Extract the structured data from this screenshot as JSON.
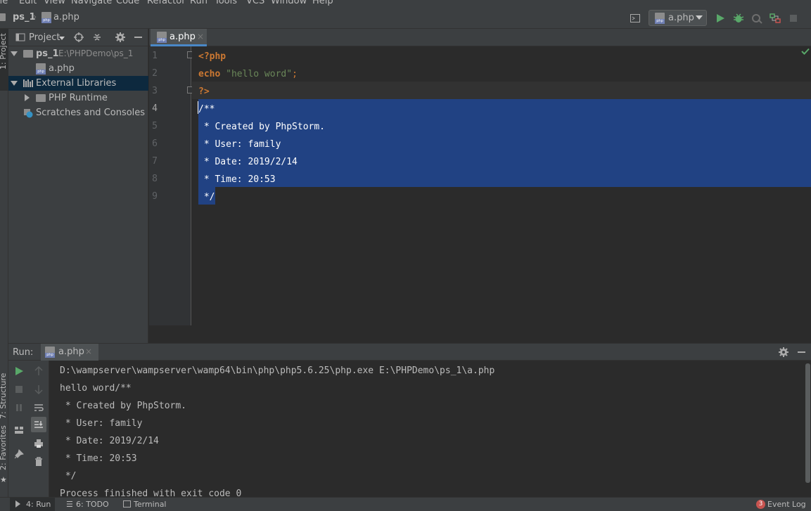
{
  "menu": [
    "ile",
    "Edit",
    "View",
    "Navigate",
    "Code",
    "Refactor",
    "Run",
    "Tools",
    "VCS",
    "Window",
    "Help"
  ],
  "navbar": {
    "project_crumb": "ps_1",
    "file_crumb": "a.php",
    "run_config": "a.php"
  },
  "left_stripe": {
    "project_tab": "1: Project",
    "structure_tab": "7: Structure",
    "favorites_tab": "2: Favorites"
  },
  "project_panel": {
    "view_selector": "Project",
    "tree": [
      {
        "label": "ps_1",
        "path": "E:\\PHPDemo\\ps_1"
      },
      {
        "label": "a.php"
      },
      {
        "label": "External Libraries"
      },
      {
        "label": "PHP Runtime"
      },
      {
        "label": "Scratches and Consoles"
      }
    ]
  },
  "editor": {
    "tab_label": "a.php",
    "line_numbers": [
      "1",
      "2",
      "3",
      "4",
      "5",
      "6",
      "7",
      "8",
      "9"
    ],
    "lines": [
      {
        "kw": "<?php"
      },
      {
        "kw": "echo",
        "str": "\"hello word\"",
        "punct": ";"
      },
      {
        "kw": "?>"
      },
      {
        "comment": "/**"
      },
      {
        "comment": " * Created by PhpStorm."
      },
      {
        "comment": " * User: family"
      },
      {
        "comment": " * Date: 2019/2/14"
      },
      {
        "comment": " * Time: 20:53"
      },
      {
        "comment": " */"
      }
    ]
  },
  "run_panel": {
    "title": "Run:",
    "tab_label": "a.php",
    "output": [
      "D:\\wampserver\\wampserver\\wamp64\\bin\\php\\php5.6.25\\php.exe E:\\PHPDemo\\ps_1\\a.php",
      "hello word/**",
      " * Created by PhpStorm.",
      " * User: family",
      " * Date: 2019/2/14",
      " * Time: 20:53",
      " */",
      "Process finished with exit code 0"
    ]
  },
  "bottom_bar": {
    "run": "4: Run",
    "todo": "6: TODO",
    "terminal": "Terminal",
    "event_count": "3",
    "event_log": "Event Log"
  },
  "colors": {
    "keyword": "#cc7832",
    "string": "#6a8759",
    "comment": "#ffffff",
    "selection": "#214283",
    "run_green": "#59a869",
    "accent": "#4a88c7"
  }
}
